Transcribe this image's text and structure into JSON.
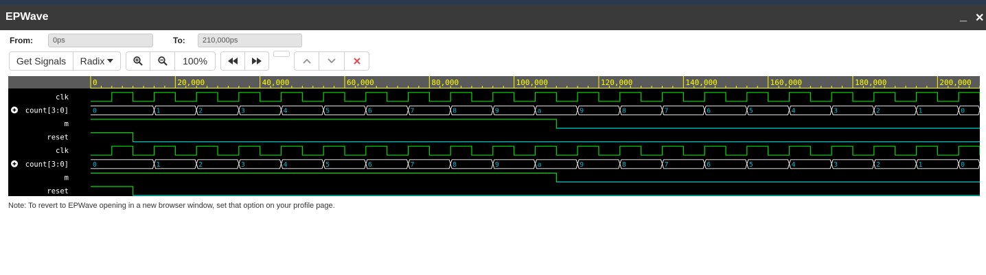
{
  "app": {
    "title": "EPWave",
    "minimize_label": "_",
    "close_label": "✕"
  },
  "range": {
    "from_label": "From:",
    "from_value": "0ps",
    "to_label": "To:",
    "to_value": "210,000ps"
  },
  "toolbar": {
    "get_signals_label": "Get Signals",
    "radix_label": "Radix",
    "zoom_label": "100%",
    "icons": [
      "zoom-in-icon",
      "zoom-out-icon",
      "rewind-icon",
      "fast-forward-icon",
      "chevron-up-icon",
      "chevron-down-icon",
      "delete-icon"
    ]
  },
  "colors": {
    "wave_bg": "#000000",
    "ruler_bg": "#5a5a5a",
    "ruler_text": "#ffff00",
    "signal_green": "#00e000",
    "signal_cyan": "#00b4c8",
    "bus_line": "#ffffff",
    "delete_red": "#e0505a"
  },
  "waveform": {
    "time_start": 0,
    "time_end": 210000,
    "time_unit": "ps",
    "ruler_ticks": [
      "0",
      "20,000",
      "40,000",
      "60,000",
      "80,000",
      "100,000",
      "120,000",
      "140,000",
      "160,000",
      "180,000",
      "200,000"
    ],
    "clock_period": 10000,
    "signals": [
      {
        "name": "clk",
        "kind": "clock",
        "expandable": false
      },
      {
        "name": "count[3:0]",
        "kind": "bus",
        "expandable": true,
        "segments": [
          {
            "t": 0,
            "v": "0"
          },
          {
            "t": 15000,
            "v": "1"
          },
          {
            "t": 25000,
            "v": "2"
          },
          {
            "t": 35000,
            "v": "3"
          },
          {
            "t": 45000,
            "v": "4"
          },
          {
            "t": 55000,
            "v": "5"
          },
          {
            "t": 65000,
            "v": "6"
          },
          {
            "t": 75000,
            "v": "7"
          },
          {
            "t": 85000,
            "v": "8"
          },
          {
            "t": 95000,
            "v": "9"
          },
          {
            "t": 105000,
            "v": "a"
          },
          {
            "t": 115000,
            "v": "9"
          },
          {
            "t": 125000,
            "v": "8"
          },
          {
            "t": 135000,
            "v": "7"
          },
          {
            "t": 145000,
            "v": "6"
          },
          {
            "t": 155000,
            "v": "5"
          },
          {
            "t": 165000,
            "v": "4"
          },
          {
            "t": 175000,
            "v": "3"
          },
          {
            "t": 185000,
            "v": "2"
          },
          {
            "t": 195000,
            "v": "1"
          },
          {
            "t": 205000,
            "v": "0"
          }
        ]
      },
      {
        "name": "m",
        "kind": "bit",
        "transitions": [
          {
            "t": 0,
            "v": 1
          },
          {
            "t": 110000,
            "v": 0
          }
        ]
      },
      {
        "name": "reset",
        "kind": "bit",
        "transitions": [
          {
            "t": 0,
            "v": 1
          },
          {
            "t": 10000,
            "v": 0
          }
        ]
      },
      {
        "name": "clk",
        "kind": "clock",
        "expandable": false
      },
      {
        "name": "count[3:0]",
        "kind": "bus",
        "expandable": true,
        "segments": [
          {
            "t": 0,
            "v": "0"
          },
          {
            "t": 15000,
            "v": "1"
          },
          {
            "t": 25000,
            "v": "2"
          },
          {
            "t": 35000,
            "v": "3"
          },
          {
            "t": 45000,
            "v": "4"
          },
          {
            "t": 55000,
            "v": "5"
          },
          {
            "t": 65000,
            "v": "6"
          },
          {
            "t": 75000,
            "v": "7"
          },
          {
            "t": 85000,
            "v": "8"
          },
          {
            "t": 95000,
            "v": "9"
          },
          {
            "t": 105000,
            "v": "a"
          },
          {
            "t": 115000,
            "v": "9"
          },
          {
            "t": 125000,
            "v": "8"
          },
          {
            "t": 135000,
            "v": "7"
          },
          {
            "t": 145000,
            "v": "6"
          },
          {
            "t": 155000,
            "v": "5"
          },
          {
            "t": 165000,
            "v": "4"
          },
          {
            "t": 175000,
            "v": "3"
          },
          {
            "t": 185000,
            "v": "2"
          },
          {
            "t": 195000,
            "v": "1"
          },
          {
            "t": 205000,
            "v": "0"
          }
        ]
      },
      {
        "name": "m",
        "kind": "bit",
        "transitions": [
          {
            "t": 0,
            "v": 1
          },
          {
            "t": 110000,
            "v": 0
          }
        ]
      },
      {
        "name": "reset",
        "kind": "bit",
        "transitions": [
          {
            "t": 0,
            "v": 1
          },
          {
            "t": 10000,
            "v": 0
          }
        ]
      }
    ]
  },
  "note": "Note: To revert to EPWave opening in a new browser window, set that option on your profile page."
}
